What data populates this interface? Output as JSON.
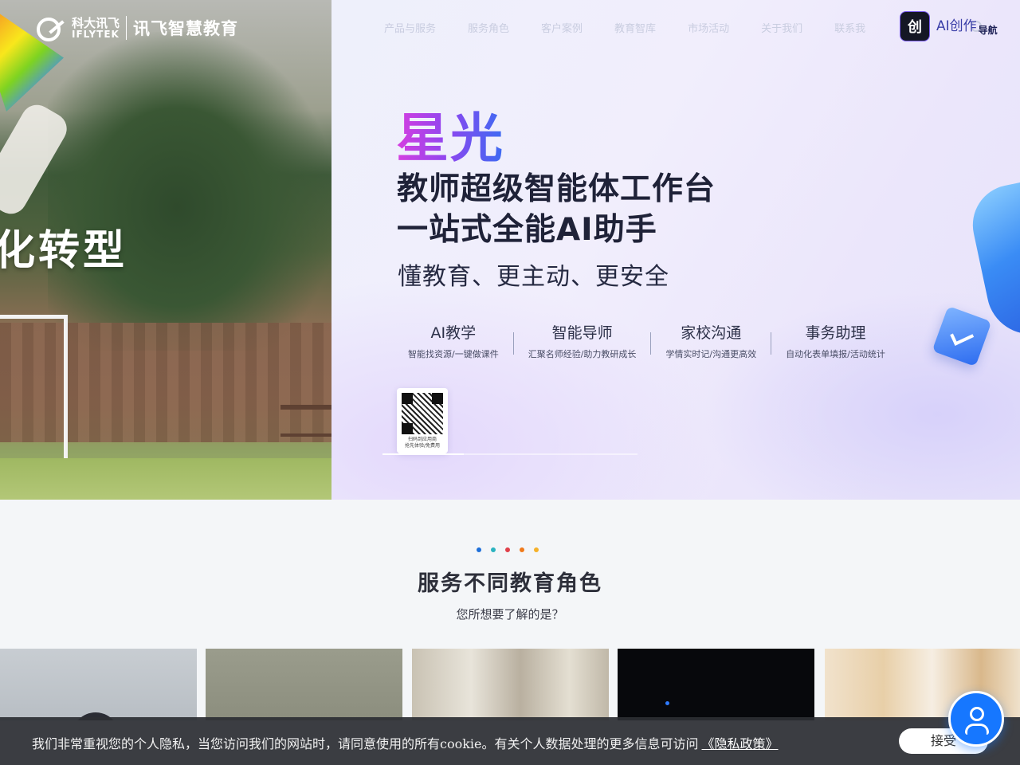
{
  "brand": {
    "logo_cn": "科大讯飞",
    "logo_en": "IFLYTEK",
    "product": "讯飞智慧教育"
  },
  "nav": {
    "items": [
      "产品与服务",
      "服务角色",
      "客户案例",
      "教育智库",
      "市场活动",
      "关于我们",
      "联系我"
    ]
  },
  "ai_badge": {
    "icon_char": "创",
    "line1": "AI创作",
    "line2": "导航"
  },
  "hero": {
    "left_slogan": "化转型",
    "title": "星光",
    "subtitle1": "教师超级智能体工作台",
    "subtitle2": "一站式全能AI助手",
    "tagline": "懂教育、更主动、更安全",
    "features": [
      {
        "title": "AI教学",
        "desc": "智能找资源/一键做课件"
      },
      {
        "title": "智能导师",
        "desc": "汇聚名师经验/助力教研成长"
      },
      {
        "title": "家校沟通",
        "desc": "学情实时记/沟通更高效"
      },
      {
        "title": "事务助理",
        "desc": "自动化表单填报/活动统计"
      }
    ],
    "qr_caption_line1": "扫码到应用商",
    "qr_caption_line2": "抢先体验/免费用",
    "carousel_progress": 0.32
  },
  "services": {
    "dot_colors": [
      "#1e6fd9",
      "#2bb3c0",
      "#e0414a",
      "#f07a1a",
      "#f5b12a"
    ],
    "title": "服务不同教育角色",
    "subtitle": "您所想要了解的是？"
  },
  "cookie": {
    "text": "我们非常重视您的个人隐私，当您访问我们的网站时，请同意使用的所有cookie。有关个人数据处理的更多信息可访问",
    "link": "《隐私政策》",
    "accept": "接受"
  }
}
